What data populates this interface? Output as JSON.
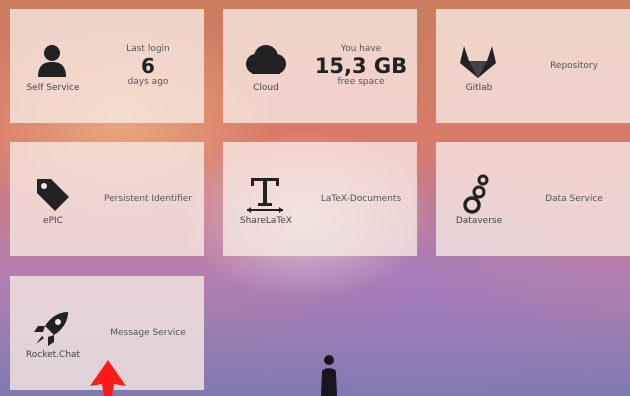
{
  "tiles": [
    {
      "id": "self-service",
      "label": "Self Service",
      "icon": "person-icon",
      "info": {
        "top": "Last login",
        "value": "6",
        "bottom": "days ago"
      }
    },
    {
      "id": "cloud",
      "label": "Cloud",
      "icon": "cloud-icon",
      "info": {
        "top": "You have",
        "value": "15,3 GB",
        "bottom": "free space"
      }
    },
    {
      "id": "gitlab",
      "label": "Gitlab",
      "icon": "gitlab-icon",
      "info": {
        "text": "Repository"
      }
    },
    {
      "id": "epic",
      "label": "ePIC",
      "icon": "tag-icon",
      "info": {
        "text": "Persistent Identifier"
      }
    },
    {
      "id": "sharelatex",
      "label": "ShareLaTeX",
      "icon": "text-format-icon",
      "info": {
        "text": "LaTeX-Documents"
      }
    },
    {
      "id": "dataverse",
      "label": "Dataverse",
      "icon": "dataverse-icon",
      "info": {
        "text": "Data Service"
      }
    },
    {
      "id": "rocketchat",
      "label": "Rocket.Chat",
      "icon": "rocket-icon",
      "info": {
        "text": "Message Service"
      }
    }
  ],
  "colors": {
    "tile_bg": "#f6e8e2",
    "icon": "#222222",
    "text": "#555555",
    "arrow": "#ff1a1a"
  }
}
